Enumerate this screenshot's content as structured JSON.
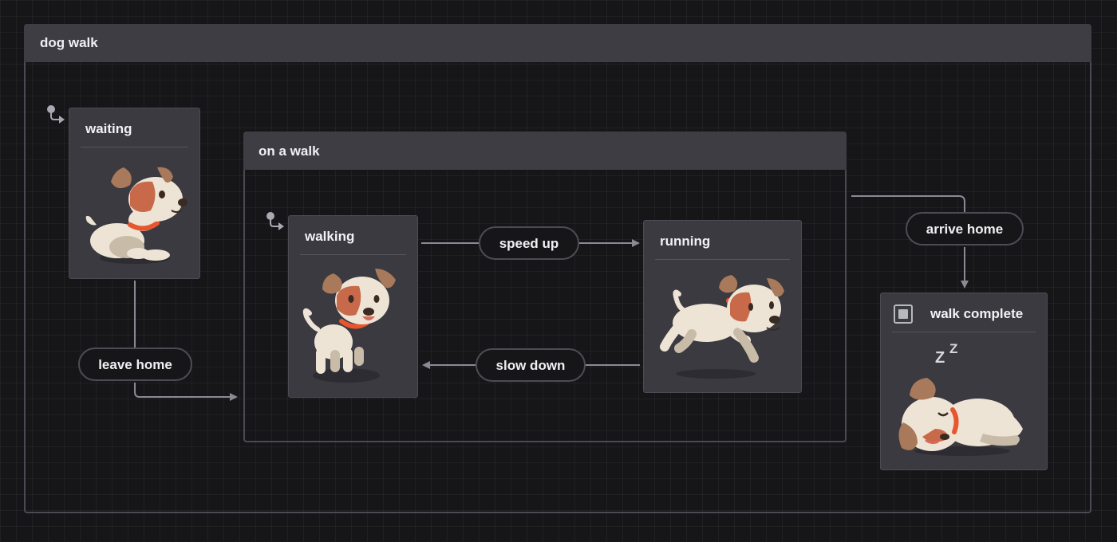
{
  "diagram": {
    "root": {
      "label": "dog walk"
    },
    "compound": {
      "label": "on a walk"
    },
    "states": {
      "waiting": {
        "label": "waiting"
      },
      "walking": {
        "label": "walking"
      },
      "running": {
        "label": "running"
      },
      "walk_complete": {
        "label": "walk complete"
      }
    },
    "transitions": {
      "leave_home": {
        "label": "leave home"
      },
      "speed_up": {
        "label": "speed up"
      },
      "slow_down": {
        "label": "slow down"
      },
      "arrive_home": {
        "label": "arrive home"
      }
    },
    "sleep_text": {
      "z1": "Z",
      "z2": "Z"
    }
  },
  "colors": {
    "background": "#161618",
    "frame": "#4a4a52",
    "header": "#3d3d43",
    "state": "#3a3a40",
    "edge": "#8a8a94",
    "dog_body": "#ede4d6",
    "dog_patch": "#c8694a",
    "dog_ear": "#a8795a",
    "collar": "#e8552e"
  },
  "icons": {
    "initial": "initial-state-icon",
    "final": "final-state-icon"
  }
}
